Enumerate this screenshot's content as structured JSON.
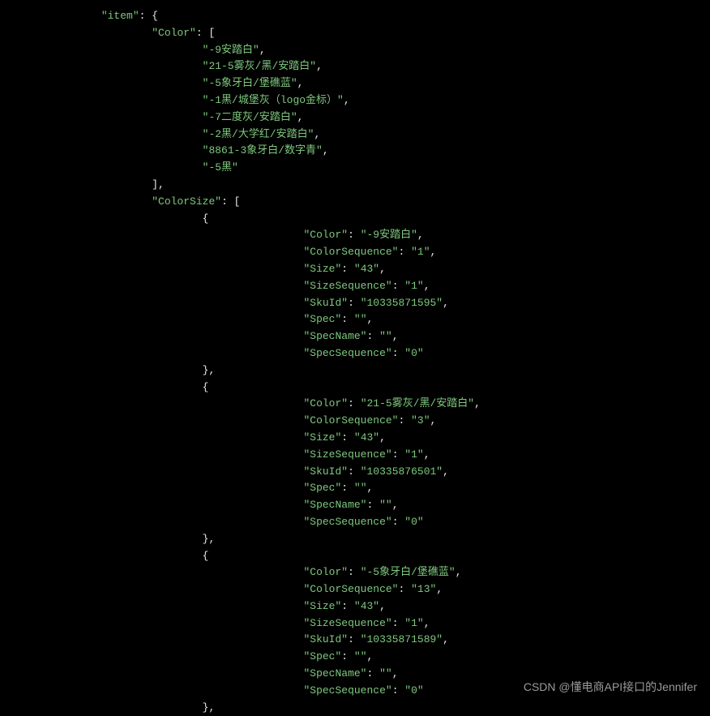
{
  "watermark": "CSDN @懂电商API接口的Jennifer",
  "indent": {
    "l1": "                ",
    "l2": "                        ",
    "l3": "                                ",
    "l4": "                                        ",
    "l5": "                                                "
  },
  "root_key": "item",
  "keys": {
    "Color": "Color",
    "ColorSize": "ColorSize",
    "ColorSequence": "ColorSequence",
    "Size": "Size",
    "SizeSequence": "SizeSequence",
    "SkuId": "SkuId",
    "Spec": "Spec",
    "SpecName": "SpecName",
    "SpecSequence": "SpecSequence"
  },
  "colors": [
    "-9安踏白",
    "21-5雾灰/黑/安踏白",
    "-5象牙白/堡礁蓝",
    "-1黑/城堡灰（logo金标）",
    "-7二度灰/安踏白",
    "-2黑/大学红/安踏白",
    "8861-3象牙白/数字青",
    "-5黑"
  ],
  "colorSize": [
    {
      "Color": "-9安踏白",
      "ColorSequence": "1",
      "Size": "43",
      "SizeSequence": "1",
      "SkuId": "10335871595",
      "Spec": "",
      "SpecName": "",
      "SpecSequence": "0"
    },
    {
      "Color": "21-5雾灰/黑/安踏白",
      "ColorSequence": "3",
      "Size": "43",
      "SizeSequence": "1",
      "SkuId": "10335876501",
      "Spec": "",
      "SpecName": "",
      "SpecSequence": "0"
    },
    {
      "Color": "-5象牙白/堡礁蓝",
      "ColorSequence": "13",
      "Size": "43",
      "SizeSequence": "1",
      "SkuId": "10335871589",
      "Spec": "",
      "SpecName": "",
      "SpecSequence": "0"
    }
  ]
}
